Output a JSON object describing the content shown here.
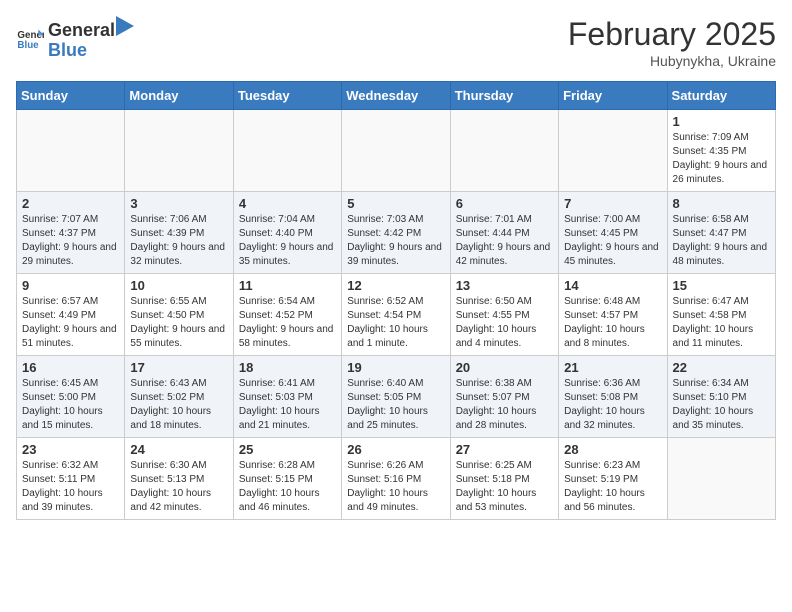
{
  "header": {
    "logo_general": "General",
    "logo_blue": "Blue",
    "month_year": "February 2025",
    "location": "Hubynykha, Ukraine"
  },
  "days_of_week": [
    "Sunday",
    "Monday",
    "Tuesday",
    "Wednesday",
    "Thursday",
    "Friday",
    "Saturday"
  ],
  "weeks": [
    [
      {
        "day": "",
        "info": ""
      },
      {
        "day": "",
        "info": ""
      },
      {
        "day": "",
        "info": ""
      },
      {
        "day": "",
        "info": ""
      },
      {
        "day": "",
        "info": ""
      },
      {
        "day": "",
        "info": ""
      },
      {
        "day": "1",
        "info": "Sunrise: 7:09 AM\nSunset: 4:35 PM\nDaylight: 9 hours and 26 minutes."
      }
    ],
    [
      {
        "day": "2",
        "info": "Sunrise: 7:07 AM\nSunset: 4:37 PM\nDaylight: 9 hours and 29 minutes."
      },
      {
        "day": "3",
        "info": "Sunrise: 7:06 AM\nSunset: 4:39 PM\nDaylight: 9 hours and 32 minutes."
      },
      {
        "day": "4",
        "info": "Sunrise: 7:04 AM\nSunset: 4:40 PM\nDaylight: 9 hours and 35 minutes."
      },
      {
        "day": "5",
        "info": "Sunrise: 7:03 AM\nSunset: 4:42 PM\nDaylight: 9 hours and 39 minutes."
      },
      {
        "day": "6",
        "info": "Sunrise: 7:01 AM\nSunset: 4:44 PM\nDaylight: 9 hours and 42 minutes."
      },
      {
        "day": "7",
        "info": "Sunrise: 7:00 AM\nSunset: 4:45 PM\nDaylight: 9 hours and 45 minutes."
      },
      {
        "day": "8",
        "info": "Sunrise: 6:58 AM\nSunset: 4:47 PM\nDaylight: 9 hours and 48 minutes."
      }
    ],
    [
      {
        "day": "9",
        "info": "Sunrise: 6:57 AM\nSunset: 4:49 PM\nDaylight: 9 hours and 51 minutes."
      },
      {
        "day": "10",
        "info": "Sunrise: 6:55 AM\nSunset: 4:50 PM\nDaylight: 9 hours and 55 minutes."
      },
      {
        "day": "11",
        "info": "Sunrise: 6:54 AM\nSunset: 4:52 PM\nDaylight: 9 hours and 58 minutes."
      },
      {
        "day": "12",
        "info": "Sunrise: 6:52 AM\nSunset: 4:54 PM\nDaylight: 10 hours and 1 minute."
      },
      {
        "day": "13",
        "info": "Sunrise: 6:50 AM\nSunset: 4:55 PM\nDaylight: 10 hours and 4 minutes."
      },
      {
        "day": "14",
        "info": "Sunrise: 6:48 AM\nSunset: 4:57 PM\nDaylight: 10 hours and 8 minutes."
      },
      {
        "day": "15",
        "info": "Sunrise: 6:47 AM\nSunset: 4:58 PM\nDaylight: 10 hours and 11 minutes."
      }
    ],
    [
      {
        "day": "16",
        "info": "Sunrise: 6:45 AM\nSunset: 5:00 PM\nDaylight: 10 hours and 15 minutes."
      },
      {
        "day": "17",
        "info": "Sunrise: 6:43 AM\nSunset: 5:02 PM\nDaylight: 10 hours and 18 minutes."
      },
      {
        "day": "18",
        "info": "Sunrise: 6:41 AM\nSunset: 5:03 PM\nDaylight: 10 hours and 21 minutes."
      },
      {
        "day": "19",
        "info": "Sunrise: 6:40 AM\nSunset: 5:05 PM\nDaylight: 10 hours and 25 minutes."
      },
      {
        "day": "20",
        "info": "Sunrise: 6:38 AM\nSunset: 5:07 PM\nDaylight: 10 hours and 28 minutes."
      },
      {
        "day": "21",
        "info": "Sunrise: 6:36 AM\nSunset: 5:08 PM\nDaylight: 10 hours and 32 minutes."
      },
      {
        "day": "22",
        "info": "Sunrise: 6:34 AM\nSunset: 5:10 PM\nDaylight: 10 hours and 35 minutes."
      }
    ],
    [
      {
        "day": "23",
        "info": "Sunrise: 6:32 AM\nSunset: 5:11 PM\nDaylight: 10 hours and 39 minutes."
      },
      {
        "day": "24",
        "info": "Sunrise: 6:30 AM\nSunset: 5:13 PM\nDaylight: 10 hours and 42 minutes."
      },
      {
        "day": "25",
        "info": "Sunrise: 6:28 AM\nSunset: 5:15 PM\nDaylight: 10 hours and 46 minutes."
      },
      {
        "day": "26",
        "info": "Sunrise: 6:26 AM\nSunset: 5:16 PM\nDaylight: 10 hours and 49 minutes."
      },
      {
        "day": "27",
        "info": "Sunrise: 6:25 AM\nSunset: 5:18 PM\nDaylight: 10 hours and 53 minutes."
      },
      {
        "day": "28",
        "info": "Sunrise: 6:23 AM\nSunset: 5:19 PM\nDaylight: 10 hours and 56 minutes."
      },
      {
        "day": "",
        "info": ""
      }
    ]
  ]
}
